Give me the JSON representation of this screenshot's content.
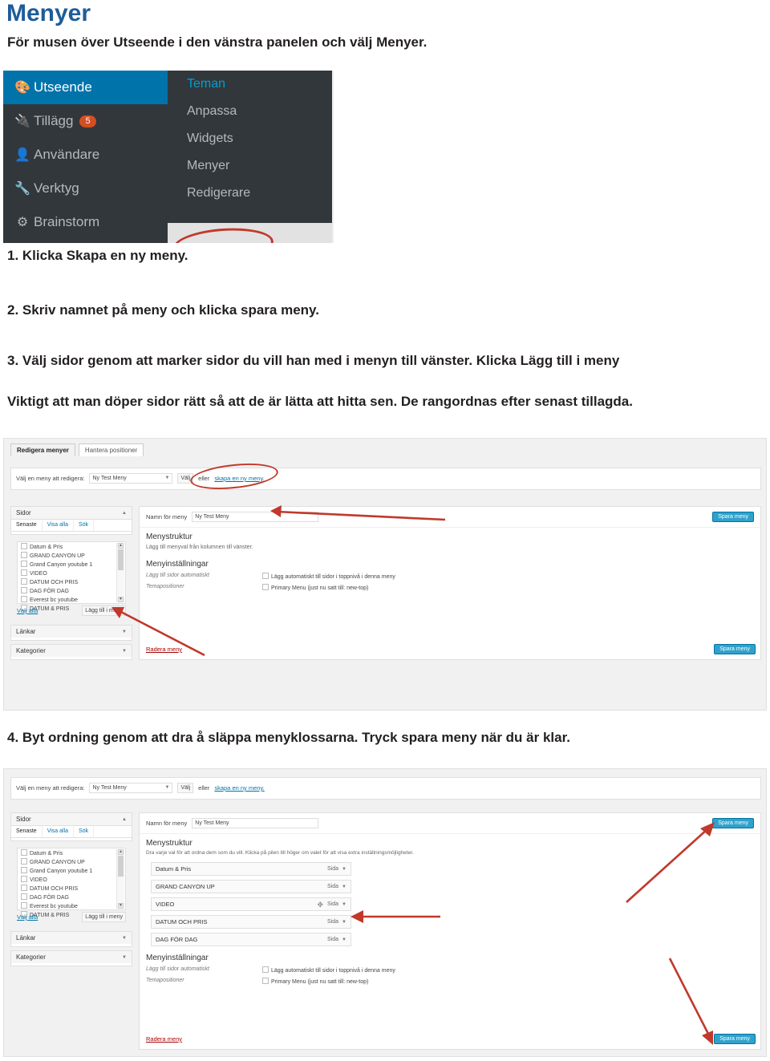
{
  "doc": {
    "title": "Menyer",
    "intro": "För musen över Utseende i den vänstra panelen och välj Menyer.",
    "steps": {
      "s1": "1. Klicka Skapa en ny meny.",
      "s2": "2. Skriv namnet på meny och klicka spara meny.",
      "s3": "3. Välj sidor genom att marker sidor du vill han med i menyn till vänster.  Klicka Lägg till i meny",
      "s3b": "Viktigt att man döper sidor rätt så att de är lätta att hitta sen.  De rangordnas efter senast tillagda.",
      "s4": "4. Byt ordning genom att dra å släppa menyklossarna. Tryck spara meny när du är klar."
    }
  },
  "shot1": {
    "menu": [
      {
        "label": "Utseende",
        "icon": "brush-icon",
        "badge": "",
        "active": true
      },
      {
        "label": "Tillägg",
        "icon": "plug-icon",
        "badge": "5",
        "active": false
      },
      {
        "label": "Användare",
        "icon": "user-icon",
        "badge": "",
        "active": false
      },
      {
        "label": "Verktyg",
        "icon": "wrench-icon",
        "badge": "",
        "active": false
      },
      {
        "label": "Brainstorm",
        "icon": "brainstorm-icon",
        "badge": "",
        "active": false
      }
    ],
    "submenu": [
      {
        "label": "Teman",
        "highlight": true
      },
      {
        "label": "Anpassa",
        "highlight": false
      },
      {
        "label": "Widgets",
        "highlight": false
      },
      {
        "label": "Menyer",
        "highlight": false
      },
      {
        "label": "Redigerare",
        "highlight": false
      }
    ],
    "annotation": "oval-highlight-menyer"
  },
  "shot2": {
    "tabs": [
      {
        "label": "Redigera menyer",
        "selected": true
      },
      {
        "label": "Hantera positioner",
        "selected": false
      }
    ],
    "select_row": {
      "label": "Välj en meny att redigera:",
      "select_value": "Ny Test Meny",
      "button": "Välj",
      "or_text": "eller",
      "link": "skapa en ny meny."
    },
    "left_panel": {
      "title": "Sidor",
      "subtabs": [
        "Senaste",
        "Visa alla",
        "Sök"
      ],
      "items": [
        {
          "label": "Datum & Pris",
          "checked": true
        },
        {
          "label": "GRAND CANYON UP",
          "checked": true
        },
        {
          "label": "Grand Canyon youtube 1",
          "checked": false
        },
        {
          "label": "VIDEO",
          "checked": true
        },
        {
          "label": "DATUM OCH PRIS",
          "checked": true
        },
        {
          "label": "DAG FÖR DAG",
          "checked": true
        },
        {
          "label": "Everest bc youtube",
          "checked": false
        },
        {
          "label": "DATUM & PRIS",
          "checked": true
        }
      ],
      "select_all": "Välj alla",
      "add_button": "Lägg till i meny",
      "other_panels": [
        "Länkar",
        "Kategorier"
      ]
    },
    "right_panel": {
      "name_label": "Namn för meny",
      "name_value": "Ny Test Meny",
      "save_button": "Spara meny",
      "structure_title": "Menystruktur",
      "structure_help": "Lägg till menyval från kolumnen till vänster.",
      "settings_title": "Menyinställningar",
      "auto_add_label": "Lägg till sidor automatiskt",
      "auto_add_checkbox": "Lägg automatiskt till sidor i toppnivå i denna meny",
      "positions_label": "Temapositioner",
      "positions_checkbox": "Primary Menu (just nu satt till: new-top)",
      "delete_link": "Radera meny",
      "save_button_bottom": "Spara meny"
    },
    "annotations": [
      "arrow-to-create-menu-link",
      "oval-highlight-create-menu",
      "arrow-to-menu-name",
      "arrow-to-add-to-menu"
    ]
  },
  "shot3": {
    "select_row": {
      "label": "Välj en meny att redigera:",
      "select_value": "Ny Test Meny",
      "button": "Välj",
      "or_text": "eller",
      "link": "skapa en ny meny."
    },
    "left_panel": {
      "title": "Sidor",
      "subtabs": [
        "Senaste",
        "Visa alla",
        "Sök"
      ],
      "items": [
        {
          "label": "Datum & Pris",
          "checked": false
        },
        {
          "label": "GRAND CANYON UP",
          "checked": false
        },
        {
          "label": "Grand Canyon youtube 1",
          "checked": false
        },
        {
          "label": "VIDEO",
          "checked": false
        },
        {
          "label": "DATUM OCH PRIS",
          "checked": false
        },
        {
          "label": "DAG FÖR DAG",
          "checked": false
        },
        {
          "label": "Everest bc youtube",
          "checked": false
        },
        {
          "label": "DATUM & PRIS",
          "checked": false
        }
      ],
      "select_all": "Välj alla",
      "add_button": "Lägg till i meny",
      "other_panels": [
        "Länkar",
        "Kategorier"
      ]
    },
    "right_panel": {
      "name_label": "Namn för meny",
      "name_value": "Ny Test Meny",
      "save_button": "Spara meny",
      "structure_title": "Menystruktur",
      "structure_help": "Dra varje val för att ordna dem som du vill. Klicka på pilen till höger om valet för att visa extra inställningsmöjligheter.",
      "menu_items": [
        {
          "label": "Datum & Pris",
          "type": "Sida"
        },
        {
          "label": "GRAND CANYON UP",
          "type": "Sida"
        },
        {
          "label": "VIDEO",
          "type": "Sida"
        },
        {
          "label": "DATUM OCH PRIS",
          "type": "Sida"
        },
        {
          "label": "DAG FÖR DAG",
          "type": "Sida"
        }
      ],
      "settings_title": "Menyinställningar",
      "auto_add_label": "Lägg till sidor automatiskt",
      "auto_add_checkbox": "Lägg automatiskt till sidor i toppnivå i denna meny",
      "positions_label": "Temapositioner",
      "positions_checkbox": "Primary Menu (just nu satt till: new-top)",
      "delete_link": "Radera meny",
      "save_button_bottom": "Spara meny"
    },
    "annotations": [
      "arrow-up-to-save-menu",
      "arrow-to-drag-handle",
      "arrow-down-to-save-menu"
    ]
  },
  "colors": {
    "title": "#1f5c99",
    "accent_arrow": "#c0392b",
    "wp_blue": "#2ea2cc",
    "admin_dark": "#32373c",
    "admin_active": "#0073aa"
  }
}
